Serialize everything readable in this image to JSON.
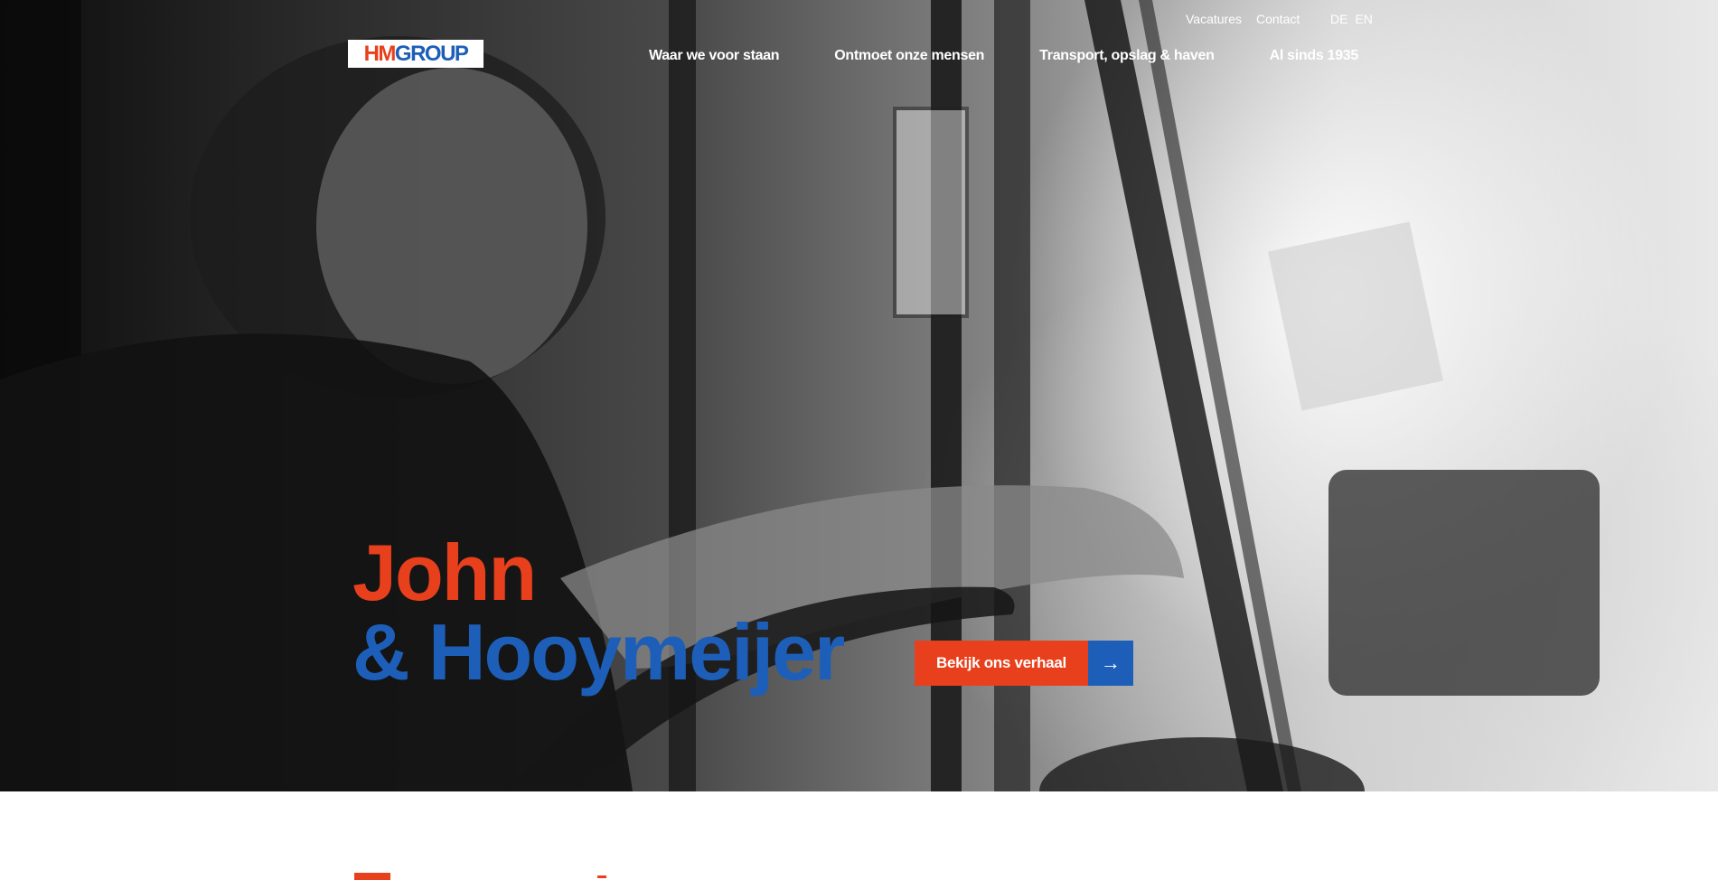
{
  "brand": {
    "logo_hm": "HM",
    "logo_group": "GROUP",
    "accent_red": "#e8401c",
    "accent_blue": "#1d5fb8"
  },
  "utility_nav": {
    "vacatures": "Vacatures",
    "contact": "Contact"
  },
  "language": {
    "de": "DE",
    "en": "EN"
  },
  "main_nav": {
    "items": [
      {
        "label": "Waar we voor staan"
      },
      {
        "label": "Ontmoet onze mensen"
      },
      {
        "label": "Transport, opslag & haven"
      },
      {
        "label": "Al sinds 1935"
      }
    ]
  },
  "hero": {
    "line1": "John",
    "line2": "& Hooymeijer",
    "cta_label": "Bekijk ons verhaal",
    "cta_icon": "arrow-right-icon",
    "cta_arrow": "→"
  }
}
